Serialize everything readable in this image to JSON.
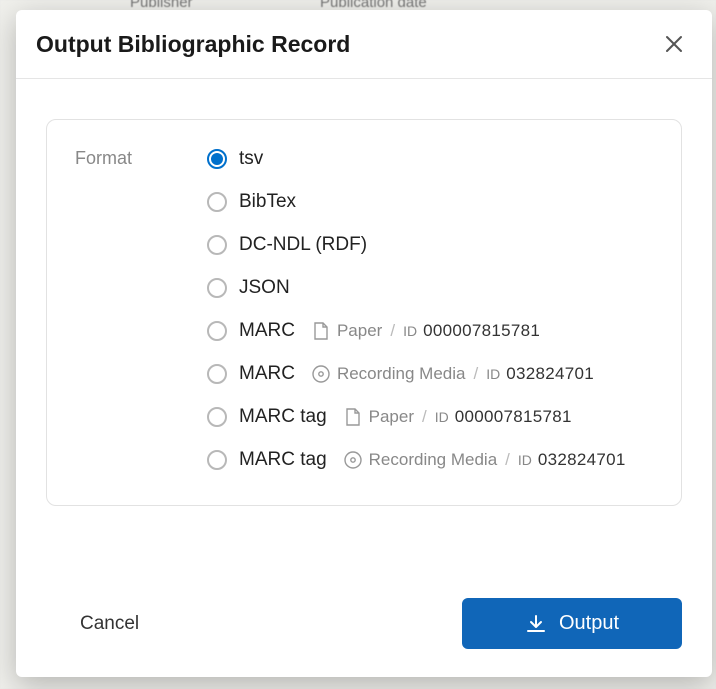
{
  "backdrop": {
    "col1": "Publisher",
    "col2": "Publication date"
  },
  "modal": {
    "title": "Output Bibliographic Record",
    "format_label": "Format",
    "options": [
      {
        "label": "tsv",
        "selected": true
      },
      {
        "label": "BibTex",
        "selected": false
      },
      {
        "label": "DC-NDL (RDF)",
        "selected": false
      },
      {
        "label": "JSON",
        "selected": false
      },
      {
        "label": "MARC",
        "selected": false,
        "media_type": "Paper",
        "id_label": "ID",
        "id_value": "000007815781",
        "icon": "paper"
      },
      {
        "label": "MARC",
        "selected": false,
        "media_type": "Recording Media",
        "id_label": "ID",
        "id_value": "032824701",
        "icon": "disc"
      },
      {
        "label": "MARC tag",
        "selected": false,
        "media_type": "Paper",
        "id_label": "ID",
        "id_value": "000007815781",
        "icon": "paper"
      },
      {
        "label": "MARC tag",
        "selected": false,
        "media_type": "Recording Media",
        "id_label": "ID",
        "id_value": "032824701",
        "icon": "disc"
      }
    ],
    "cancel": "Cancel",
    "output": "Output"
  }
}
